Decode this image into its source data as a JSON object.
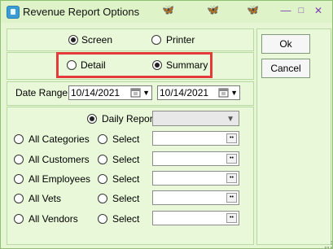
{
  "window": {
    "title": "Revenue Report Options",
    "controls": {
      "minimize": "—",
      "maximize": "□",
      "close": "✕"
    }
  },
  "output": {
    "screen_label": "Screen",
    "printer_label": "Printer",
    "selected": "screen"
  },
  "format": {
    "detail_label": "Detail",
    "summary_label": "Summary",
    "selected": "summary"
  },
  "buttons": {
    "ok_label": "Ok",
    "cancel_label": "Cancel"
  },
  "date_range": {
    "label": "Date Range",
    "start": "10/14/2021",
    "end": "10/14/2021"
  },
  "daily_report": {
    "label": "Daily Report",
    "checked": true,
    "value": ""
  },
  "filters": [
    {
      "all_label": "All Categories",
      "select_label": "Select",
      "value": ""
    },
    {
      "all_label": "All Customers",
      "select_label": "Select",
      "value": ""
    },
    {
      "all_label": "All Employees",
      "select_label": "Select",
      "value": ""
    },
    {
      "all_label": "All Vets",
      "select_label": "Select",
      "value": ""
    },
    {
      "all_label": "All Vendors",
      "select_label": "Select",
      "value": ""
    }
  ],
  "colors": {
    "background": "#e6f6d4",
    "highlight": "#e53a3a",
    "title_icon": "#3a9bd5"
  }
}
